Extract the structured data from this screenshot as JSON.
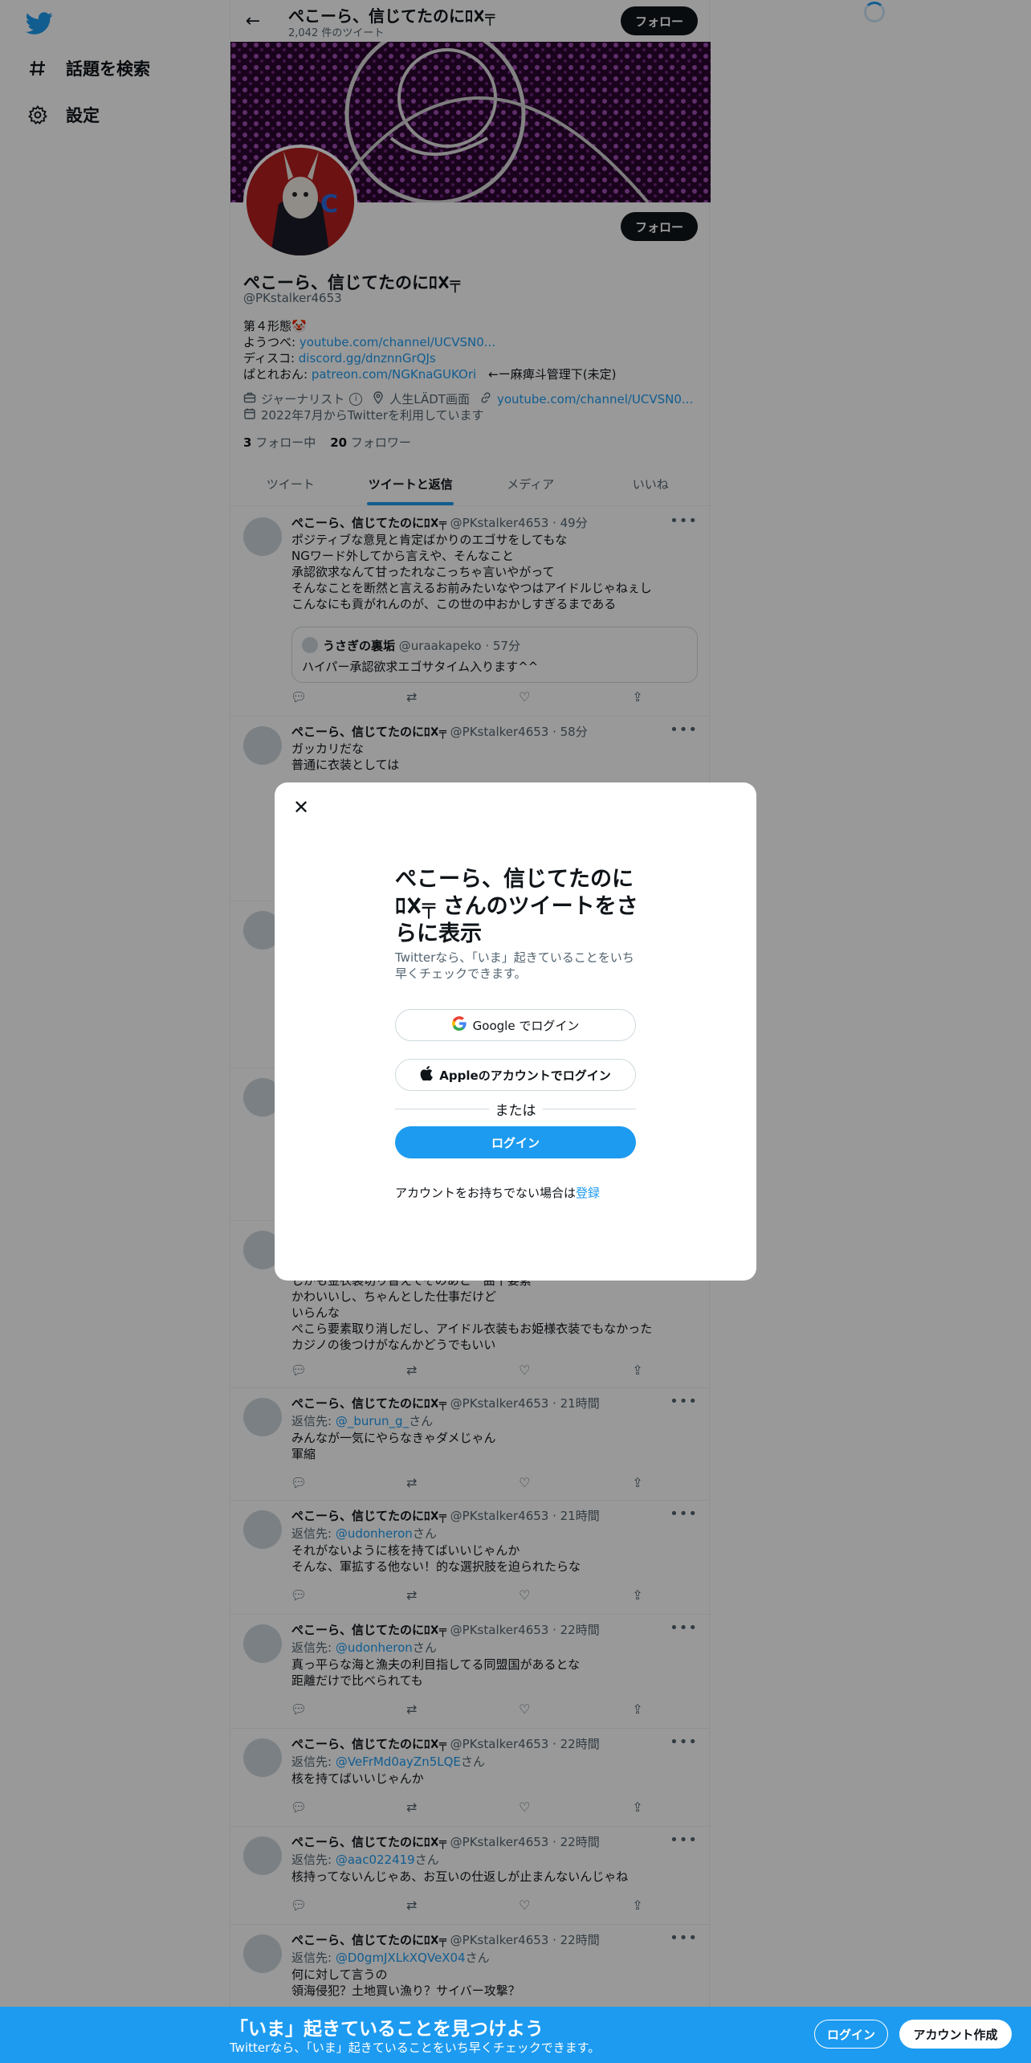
{
  "sidebar": {
    "logo_icon": "twitter-bird-icon",
    "items": [
      {
        "label": "話題を検索",
        "icon": "hashtag-icon"
      },
      {
        "label": "設定",
        "icon": "gear-icon"
      }
    ]
  },
  "header": {
    "name": "ぺこーら、信じてたのにﾛ𐌢╤",
    "tweet_count": "2,042 件のツイート",
    "follow_label": "フォロー"
  },
  "profile": {
    "name": "ぺこーら、信じてたのにﾛ𐌢╤",
    "handle": "@PKstalker4653",
    "follow_label": "フォロー",
    "bio_line1": "第４形態🤡",
    "bio_youtube_prefix": "ようつべ: ",
    "bio_youtube_link": "youtube.com/channel/UCVSN0...",
    "bio_discord_prefix": "ディスコ: ",
    "bio_discord_link": "discord.gg/dnznnGrQJs",
    "bio_patreon_prefix": "ぱとれおん: ",
    "bio_patreon_link": "patreon.com/NGKnaGUKOri",
    "bio_patreon_suffix": "　←ー麻痺斗管理下(未定)",
    "category": "ジャーナリスト",
    "location": "人生LÄDT画面",
    "website": "youtube.com/channel/UCVSN0...",
    "joined": "2022年7月からTwitterを利用しています",
    "following_count": "3",
    "following_label": "フォロー中",
    "followers_count": "20",
    "followers_label": "フォロワー"
  },
  "tabs": [
    "ツイート",
    "ツイートと返信",
    "メディア",
    "いいね"
  ],
  "tweets": [
    {
      "name": "ぺこーら、信じてたのにﾛ𐌢╤",
      "meta": "@PKstalker4653 · 49分",
      "lines": [
        "ポジティブな意見と肯定ばかりのエゴサをしてもな",
        "NGワード外してから言えや、そんなこと",
        "承認欲求なんて甘ったれなこっちゃ言いやがって",
        "そんなことを断然と言えるお前みたいなやつはアイドルじゃねぇし",
        "こんなにも貢がれんのが、この世の中おかしすぎるまである"
      ],
      "quote_name": "うさぎの裏垢",
      "quote_meta": "@uraakapeko · 57分",
      "quote_text": "ハイパー承認欲求エゴサタイム入ります^^"
    },
    {
      "name": "ぺこーら、信じてたのにﾛ𐌢╤",
      "meta": "@PKstalker4653 · 58分",
      "lines": [
        "ガッカリだな",
        "普通に衣装としては"
      ]
    },
    {
      "lines": [
        "しかも金衣装切り替えてそのあと一曲干要素",
        "かわいいし、ちゃんとした仕事だけど",
        "いらんな",
        "ぺこら要素取り消しだし、アイドル衣装もお姫様衣装でもなかった",
        "カジノの後つけがなんかどうでもいい"
      ]
    },
    {
      "name": "ぺこーら、信じてたのにﾛ𐌢╤",
      "meta": "@PKstalker4653 · 21時間",
      "reply_prefix": "返信先: ",
      "reply_to": "@_burun_g_",
      "reply_suffix": "さん",
      "lines": [
        "みんなが一気にやらなきゃダメじゃん",
        "軍縮"
      ]
    },
    {
      "name": "ぺこーら、信じてたのにﾛ𐌢╤",
      "meta": "@PKstalker4653 · 21時間",
      "reply_prefix": "返信先: ",
      "reply_to": "@udonheron",
      "reply_suffix": "さん",
      "lines": [
        "それがないように核を持てばいいじゃんか",
        "そんな、軍拡する他ない！的な選択肢を迫られたらな"
      ]
    },
    {
      "name": "ぺこーら、信じてたのにﾛ𐌢╤",
      "meta": "@PKstalker4653 · 22時間",
      "reply_prefix": "返信先: ",
      "reply_to": "@udonheron",
      "reply_suffix": "さん",
      "lines": [
        "真っ平らな海と漁夫の利目指してる同盟国があるとな",
        "距離だけで比べられても"
      ]
    },
    {
      "name": "ぺこーら、信じてたのにﾛ𐌢╤",
      "meta": "@PKstalker4653 · 22時間",
      "reply_prefix": "返信先: ",
      "reply_to": "@VeFrMd0ayZn5LQE",
      "reply_suffix": "さん",
      "lines": [
        "核を持てばいいじゃんか"
      ]
    },
    {
      "name": "ぺこーら、信じてたのにﾛ𐌢╤",
      "meta": "@PKstalker4653 · 22時間",
      "reply_prefix": "返信先: ",
      "reply_to": "@aac022419",
      "reply_suffix": "さん",
      "lines": [
        "核持ってないんじゃあ、お互いの仕返しが止まんないんじゃね"
      ]
    },
    {
      "name": "ぺこーら、信じてたのにﾛ𐌢╤",
      "meta": "@PKstalker4653 · 22時間",
      "reply_prefix": "返信先: ",
      "reply_to": "@D0gmJXLkXQVeX04",
      "reply_suffix": "さん",
      "lines": [
        "何に対して言うの",
        "領海侵犯？土地買い漁り？サイバー攻撃？"
      ]
    }
  ],
  "modal": {
    "close_icon": "close-icon",
    "title": "ぺこーら、信じてたのにﾛ𐌢╤ さんのツイートをさらに表示",
    "subtitle": "Twitterなら、「いま」起きていることをいち早くチェックできます。",
    "google_label": "Google でログイン",
    "apple_label": "Appleのアカウントでログイン",
    "or_label": "または",
    "login_label": "ログイン",
    "signup_prompt": "アカウントをお持ちでない場合は",
    "signup_link": "登録"
  },
  "bottom_bar": {
    "title": "「いま」起きていることを見つけよう",
    "subtitle": "Twitterなら、「いま」起きていることをいち早くチェックできます。",
    "login_label": "ログイン",
    "signup_label": "アカウント作成"
  },
  "colors": {
    "accent": "#1d9bf0",
    "text": "#0f1419",
    "secondary": "#536471"
  }
}
